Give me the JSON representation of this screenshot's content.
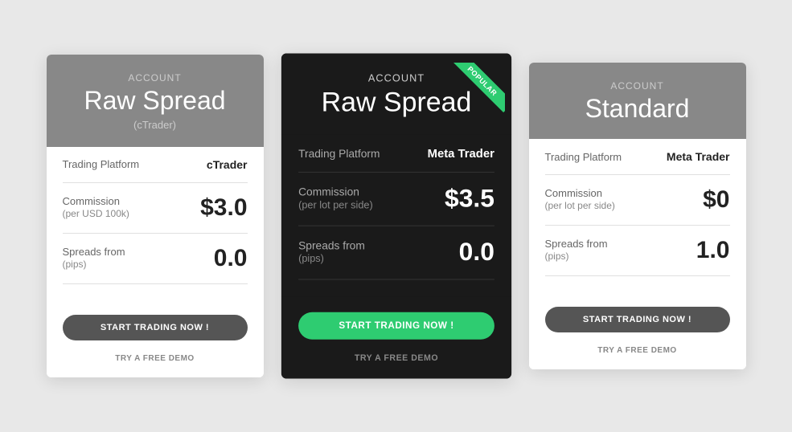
{
  "cards": [
    {
      "id": "raw-spread-ctrader",
      "header": {
        "label": "Account",
        "title": "Raw Spread",
        "subtitle": "(cTrader)"
      },
      "rows": [
        {
          "label_main": "Trading Platform",
          "label_sub": "",
          "value": "cTrader",
          "value_type": "platform"
        },
        {
          "label_main": "Commission",
          "label_sub": "(per USD 100k)",
          "value": "$3.0",
          "value_type": "number"
        },
        {
          "label_main": "Spreads from",
          "label_sub": "(pips)",
          "value": "0.0",
          "value_type": "number"
        }
      ],
      "btn_label": "START TRADING NOW !",
      "btn_type": "dark",
      "demo_label": "TRY A FREE DEMO",
      "featured": false,
      "dark": false,
      "popular": false
    },
    {
      "id": "raw-spread-metatrader",
      "header": {
        "label": "Account",
        "title": "Raw Spread",
        "subtitle": ""
      },
      "rows": [
        {
          "label_main": "Trading Platform",
          "label_sub": "",
          "value": "Meta Trader",
          "value_type": "platform"
        },
        {
          "label_main": "Commission",
          "label_sub": "(per lot per side)",
          "value": "$3.5",
          "value_type": "number"
        },
        {
          "label_main": "Spreads from",
          "label_sub": "(pips)",
          "value": "0.0",
          "value_type": "number"
        }
      ],
      "btn_label": "START TRADING NOW !",
      "btn_type": "green",
      "demo_label": "TRY A FREE DEMO",
      "featured": true,
      "dark": true,
      "popular": true,
      "popular_text": "POPULAR"
    },
    {
      "id": "standard",
      "header": {
        "label": "Account",
        "title": "Standard",
        "subtitle": ""
      },
      "rows": [
        {
          "label_main": "Trading Platform",
          "label_sub": "",
          "value": "Meta Trader",
          "value_type": "platform"
        },
        {
          "label_main": "Commission",
          "label_sub": "(per lot per side)",
          "value": "$0",
          "value_type": "number"
        },
        {
          "label_main": "Spreads from",
          "label_sub": "(pips)",
          "value": "1.0",
          "value_type": "number"
        }
      ],
      "btn_label": "START TRADING NOW !",
      "btn_type": "dark",
      "demo_label": "TRY A FREE DEMO",
      "featured": false,
      "dark": false,
      "popular": false
    }
  ]
}
